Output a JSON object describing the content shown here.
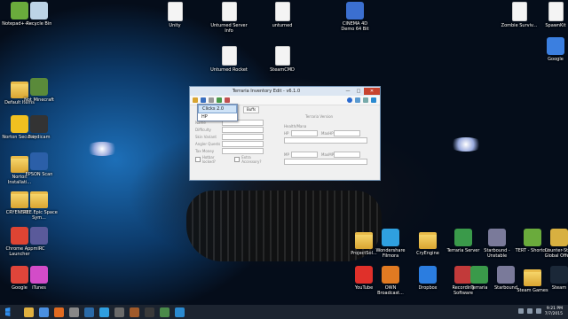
{
  "desktop": {
    "icons": [
      {
        "label": "Notepad++ - ...",
        "kind": "app",
        "color": "#6aab3c"
      },
      {
        "label": "Recycle Bin",
        "kind": "app",
        "color": "#bcd3e6"
      },
      {
        "label": "Unity",
        "kind": "file",
        "color": "#f4f4f4"
      },
      {
        "label": "Unturned Server Info",
        "kind": "file",
        "color": "#f4f4f4"
      },
      {
        "label": "unturned",
        "kind": "file",
        "color": "#f4f4f4"
      },
      {
        "label": "CINEMA 4D Demo 64 Bit",
        "kind": "app",
        "color": "#3b6fd0"
      },
      {
        "label": "Zombie Surviv...",
        "kind": "file",
        "color": "#f4f4f4"
      },
      {
        "label": "SpawnKit",
        "kind": "file",
        "color": "#f4f4f4"
      },
      {
        "label": "Unturned Rocket",
        "kind": "file",
        "color": "#f4f4f4"
      },
      {
        "label": "SteamCMD",
        "kind": "file",
        "color": "#f4f4f4"
      },
      {
        "label": "Google",
        "kind": "app",
        "color": "#3b7fe0"
      },
      {
        "label": "Default Items",
        "kind": "folder",
        "color": "#e9bb49"
      },
      {
        "label": "Not Minecraft",
        "kind": "app",
        "color": "#5a8a3a"
      },
      {
        "label": "Norton Security",
        "kind": "app",
        "color": "#f0c020"
      },
      {
        "label": "Bandicam",
        "kind": "app",
        "color": "#333333"
      },
      {
        "label": "Norton Installati...",
        "kind": "folder",
        "color": "#e9bb49"
      },
      {
        "label": "EPSON Scan",
        "kind": "app",
        "color": "#2b5fa8"
      },
      {
        "label": "CRYENGIN...",
        "kind": "folder",
        "color": "#e9bb49"
      },
      {
        "label": "FREE Epic Space Sym...",
        "kind": "folder",
        "color": "#e9bb49"
      },
      {
        "label": "Chrome App Launcher",
        "kind": "app",
        "color": "#dd4433"
      },
      {
        "label": "mIRC",
        "kind": "app",
        "color": "#5a5a9a"
      },
      {
        "label": "Google",
        "kind": "app",
        "color": "#e0453a"
      },
      {
        "label": "iTunes",
        "kind": "app",
        "color": "#d34cc8"
      },
      {
        "label": "ProjectSol...",
        "kind": "folder",
        "color": "#e9bb49"
      },
      {
        "label": "Wondershare Filmora",
        "kind": "app",
        "color": "#2fa0e0"
      },
      {
        "label": "CryEngine",
        "kind": "folder",
        "color": "#e9bb49"
      },
      {
        "label": "Terraria Server",
        "kind": "app",
        "color": "#3a9a4a"
      },
      {
        "label": "Starbound - Unstable",
        "kind": "app",
        "color": "#7a7a9a"
      },
      {
        "label": "TERT - Shortcut",
        "kind": "app",
        "color": "#6aab3c"
      },
      {
        "label": "Counter-Str... Global Offe...",
        "kind": "app",
        "color": "#d8b040"
      },
      {
        "label": "YouTube",
        "kind": "app",
        "color": "#e0302a"
      },
      {
        "label": "OWN Broadcast...",
        "kind": "app",
        "color": "#e07a22"
      },
      {
        "label": "Dropbox",
        "kind": "app",
        "color": "#2b7de0"
      },
      {
        "label": "Recording Software",
        "kind": "app",
        "color": "#c23a3a"
      },
      {
        "label": "Terraria",
        "kind": "app",
        "color": "#3a9a4a"
      },
      {
        "label": "Starbound",
        "kind": "app",
        "color": "#7a7a9a"
      },
      {
        "label": "Steam Games",
        "kind": "folder",
        "color": "#e9bb49"
      },
      {
        "label": "Steam",
        "kind": "app",
        "color": "#1b2838"
      }
    ]
  },
  "window": {
    "title": "Terraria Inventory Edit - v6.1.0",
    "minimize": "—",
    "maximize": "□",
    "close": "✕",
    "menu": {
      "item1": "Clicks 2.0",
      "item2": "HP"
    },
    "tabs": [
      "Buffs"
    ],
    "group_label": "Terraria Version",
    "fields_left": [
      {
        "label": "Name"
      },
      {
        "label": "Difficulty"
      },
      {
        "label": "Skin Variant"
      },
      {
        "label": "Angler Quests"
      },
      {
        "label": "Tax Money"
      }
    ],
    "hotbar_locked": "Hotbar locked?",
    "extra_accessory": "Extra Accessory?",
    "health_mana": "Health/Mana",
    "hp": "HP",
    "maxhp": "MaxHP",
    "mp": "MP",
    "maxmp": "MaxMP"
  },
  "taskbar": {
    "time": "9:21 PM",
    "date": "7/7/2015",
    "apps": [
      {
        "name": "file-explorer",
        "color": "#e0b040"
      },
      {
        "name": "chrome",
        "color": "#4a90e2"
      },
      {
        "name": "firefox",
        "color": "#e06a20"
      },
      {
        "name": "unity",
        "color": "#888888"
      },
      {
        "name": "photoshop",
        "color": "#2a6aa8"
      },
      {
        "name": "app",
        "color": "#2f9fe0"
      },
      {
        "name": "app",
        "color": "#6a6a6a"
      },
      {
        "name": "app",
        "color": "#a05a2a"
      },
      {
        "name": "app",
        "color": "#3a3a3a"
      },
      {
        "name": "app",
        "color": "#4a8a4a"
      },
      {
        "name": "app",
        "color": "#2a8ad0"
      }
    ]
  }
}
